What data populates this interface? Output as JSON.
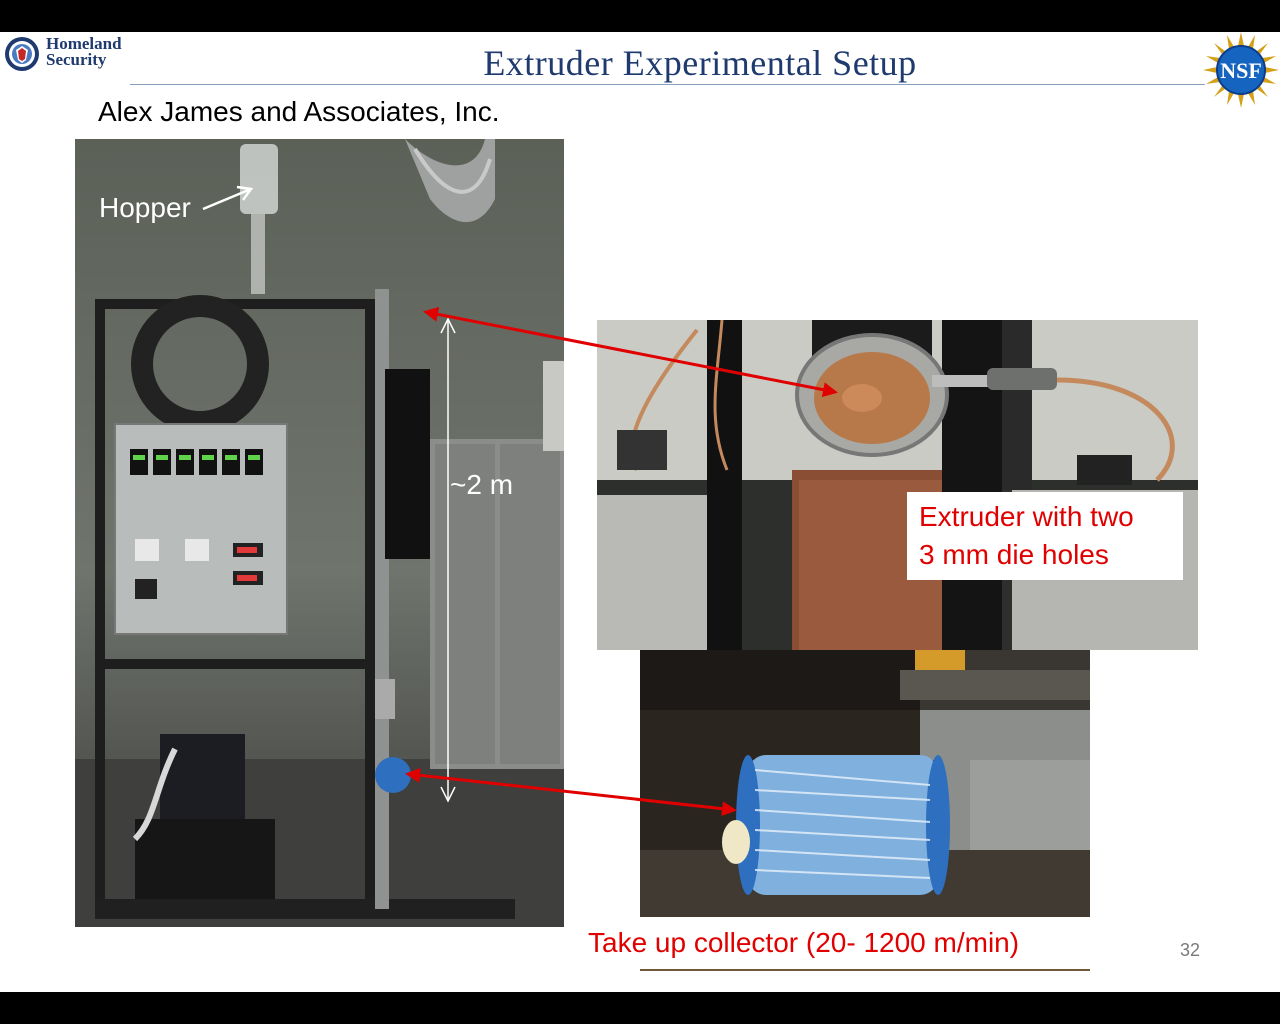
{
  "slide": {
    "title": "Extruder Experimental  Setup",
    "subtitle": "Alex James and Associates, Inc.",
    "page_number": "32"
  },
  "logos": {
    "dhs_line1": "Homeland",
    "dhs_line2": "Security",
    "nsf": "NSF"
  },
  "labels": {
    "hopper": "Hopper",
    "height": "~2 m",
    "extruder_line1": "Extruder with two",
    "extruder_line2": "3 mm die holes",
    "takeup": "Take up collector (20- 1200 m/min)"
  },
  "colors": {
    "title": "#1f3a6e",
    "callout": "#e00000",
    "arrow": "#e00000"
  }
}
